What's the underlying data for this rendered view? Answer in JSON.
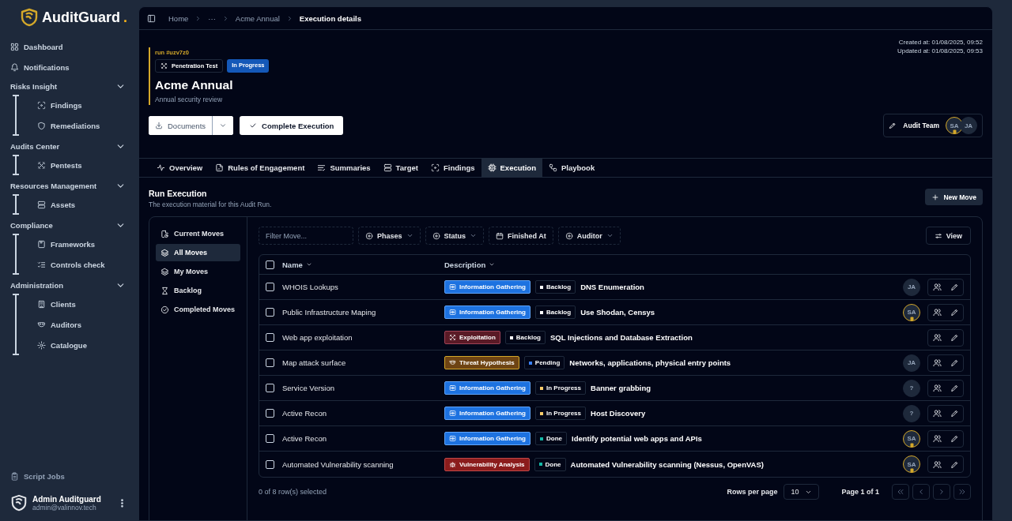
{
  "sidebar": {
    "logo": {
      "name": "AuditGuard",
      "dot": "."
    },
    "nav": [
      {
        "kind": "link",
        "label": "Dashboard"
      },
      {
        "kind": "link",
        "label": "Notifications"
      },
      {
        "kind": "group",
        "label": "Risks Insight",
        "expanded": true,
        "children": [
          {
            "label": "Findings"
          },
          {
            "label": "Remediations"
          }
        ]
      },
      {
        "kind": "group",
        "label": "Audits Center",
        "expanded": true,
        "children": [
          {
            "label": "Pentests"
          }
        ]
      },
      {
        "kind": "group",
        "label": "Resources Management",
        "expanded": true,
        "children": [
          {
            "label": "Assets"
          }
        ]
      },
      {
        "kind": "group",
        "label": "Compliance",
        "expanded": true,
        "children": [
          {
            "label": "Frameworks"
          },
          {
            "label": "Controls check"
          }
        ]
      },
      {
        "kind": "group",
        "label": "Administration",
        "expanded": true,
        "children": [
          {
            "label": "Clients"
          },
          {
            "label": "Auditors"
          },
          {
            "label": "Catalogue"
          }
        ]
      }
    ],
    "footer_link": "Script Jobs",
    "user": {
      "name": "Admin Auditguard",
      "email": "admin@valinnov.tech"
    }
  },
  "breadcrumb": [
    {
      "label": "Home",
      "current": false
    },
    {
      "label": "···",
      "current": false
    },
    {
      "label": "Acme Annual",
      "current": false
    },
    {
      "label": "Execution details",
      "current": true
    }
  ],
  "header": {
    "run_id": "run #uzv7z0",
    "type_badge": "Penetration Test",
    "status_badge": "In Progress",
    "title": "Acme Annual",
    "subtitle": "Annual security review",
    "created": "Created at: 01/08/2025, 09:52",
    "updated": "Updated at: 01/08/2025, 09:53",
    "buttons": {
      "documents": "Documents",
      "complete": "Complete Execution"
    },
    "team": {
      "label": "Audit Team",
      "members": [
        {
          "initials": "SA",
          "lead": true
        },
        {
          "initials": "JA",
          "lead": false
        }
      ]
    }
  },
  "tabs": [
    {
      "label": "Overview",
      "selected": false
    },
    {
      "label": "Rules of Engagement",
      "selected": false
    },
    {
      "label": "Summaries",
      "selected": false
    },
    {
      "label": "Target",
      "selected": false
    },
    {
      "label": "Findings",
      "selected": false
    },
    {
      "label": "Execution",
      "selected": true
    },
    {
      "label": "Playbook",
      "selected": false
    }
  ],
  "section": {
    "title": "Run Execution",
    "subtitle": "The execution material for this Audit Run.",
    "new_button": "New Move"
  },
  "moves_nav": [
    {
      "label": "Current Moves",
      "selected": false
    },
    {
      "label": "All Moves",
      "selected": true
    },
    {
      "label": "My Moves",
      "selected": false
    },
    {
      "label": "Backlog",
      "selected": false
    },
    {
      "label": "Completed Moves",
      "selected": false
    }
  ],
  "toolbar": {
    "filter": {
      "placeholder": "Filter Move..."
    },
    "filters": [
      {
        "label": "Phases",
        "kind": "multi"
      },
      {
        "label": "Status",
        "kind": "multi"
      },
      {
        "label": "Finished At",
        "kind": "date"
      },
      {
        "label": "Auditor",
        "kind": "multi"
      }
    ],
    "view": "View"
  },
  "table": {
    "columns": [
      "Name",
      "Description"
    ],
    "all_checked": false,
    "rows": [
      {
        "checked": false,
        "name": "WHOIS Lookups",
        "phase": {
          "label": "Information Gathering",
          "kind": "info",
          "color": "#1d72e0"
        },
        "status": {
          "label": "Backlog",
          "color": "#ffffff"
        },
        "description": "DNS Enumeration",
        "assignee": {
          "initials": "JA",
          "lead": false
        }
      },
      {
        "checked": false,
        "name": "Public Infrastructure Maping",
        "phase": {
          "label": "Information Gathering",
          "kind": "info",
          "color": "#1d72e0"
        },
        "status": {
          "label": "Backlog",
          "color": "#ffffff"
        },
        "description": "Use Shodan, Censys",
        "assignee": {
          "initials": "SA",
          "lead": true
        }
      },
      {
        "checked": false,
        "name": "Web app exploitation",
        "phase": {
          "label": "Exploitation",
          "kind": "exploit",
          "color": "#5a1a26"
        },
        "status": {
          "label": "Backlog",
          "color": "#ffffff"
        },
        "description": "SQL Injections and Database Extraction"
      },
      {
        "checked": false,
        "name": "Map attack surface",
        "phase": {
          "label": "Threat Hypothesis",
          "kind": "threat",
          "color": "#6e4413"
        },
        "status": {
          "label": "Pending",
          "color": "#3b82f6"
        },
        "description": "Networks, applications, physical entry points",
        "assignee": {
          "initials": "JA",
          "lead": false
        }
      },
      {
        "checked": false,
        "name": "Service Version",
        "phase": {
          "label": "Information Gathering",
          "kind": "info",
          "color": "#1d72e0"
        },
        "status": {
          "label": "In Progress",
          "color": "#facc6b"
        },
        "description": "Banner grabbing",
        "assignee": {
          "initials": "?",
          "lead": false
        }
      },
      {
        "checked": false,
        "name": "Active Recon",
        "phase": {
          "label": "Information Gathering",
          "kind": "info",
          "color": "#1d72e0"
        },
        "status": {
          "label": "In Progress",
          "color": "#facc6b"
        },
        "description": "Host Discovery",
        "assignee": {
          "initials": "?",
          "lead": false
        }
      },
      {
        "checked": false,
        "name": "Active Recon",
        "phase": {
          "label": "Information Gathering",
          "kind": "info",
          "color": "#1d72e0"
        },
        "status": {
          "label": "Done",
          "color": "#14b8a6"
        },
        "description": "Identify potential web apps and APIs",
        "assignee": {
          "initials": "SA",
          "lead": true
        }
      },
      {
        "checked": false,
        "name": "Automated Vulnerability scanning",
        "phase": {
          "label": "Vulnerability Analysis",
          "kind": "vuln",
          "color": "#8b1c1c"
        },
        "status": {
          "label": "Done",
          "color": "#14b8a6"
        },
        "description": "Automated Vulnerability scanning (Nessus, OpenVAS)",
        "assignee": {
          "initials": "SA",
          "lead": true
        }
      }
    ]
  },
  "footer": {
    "selection": "0 of 8 row(s) selected",
    "rows_per_page": "Rows per page",
    "page_size": "10",
    "page": "Page 1 of 1"
  }
}
